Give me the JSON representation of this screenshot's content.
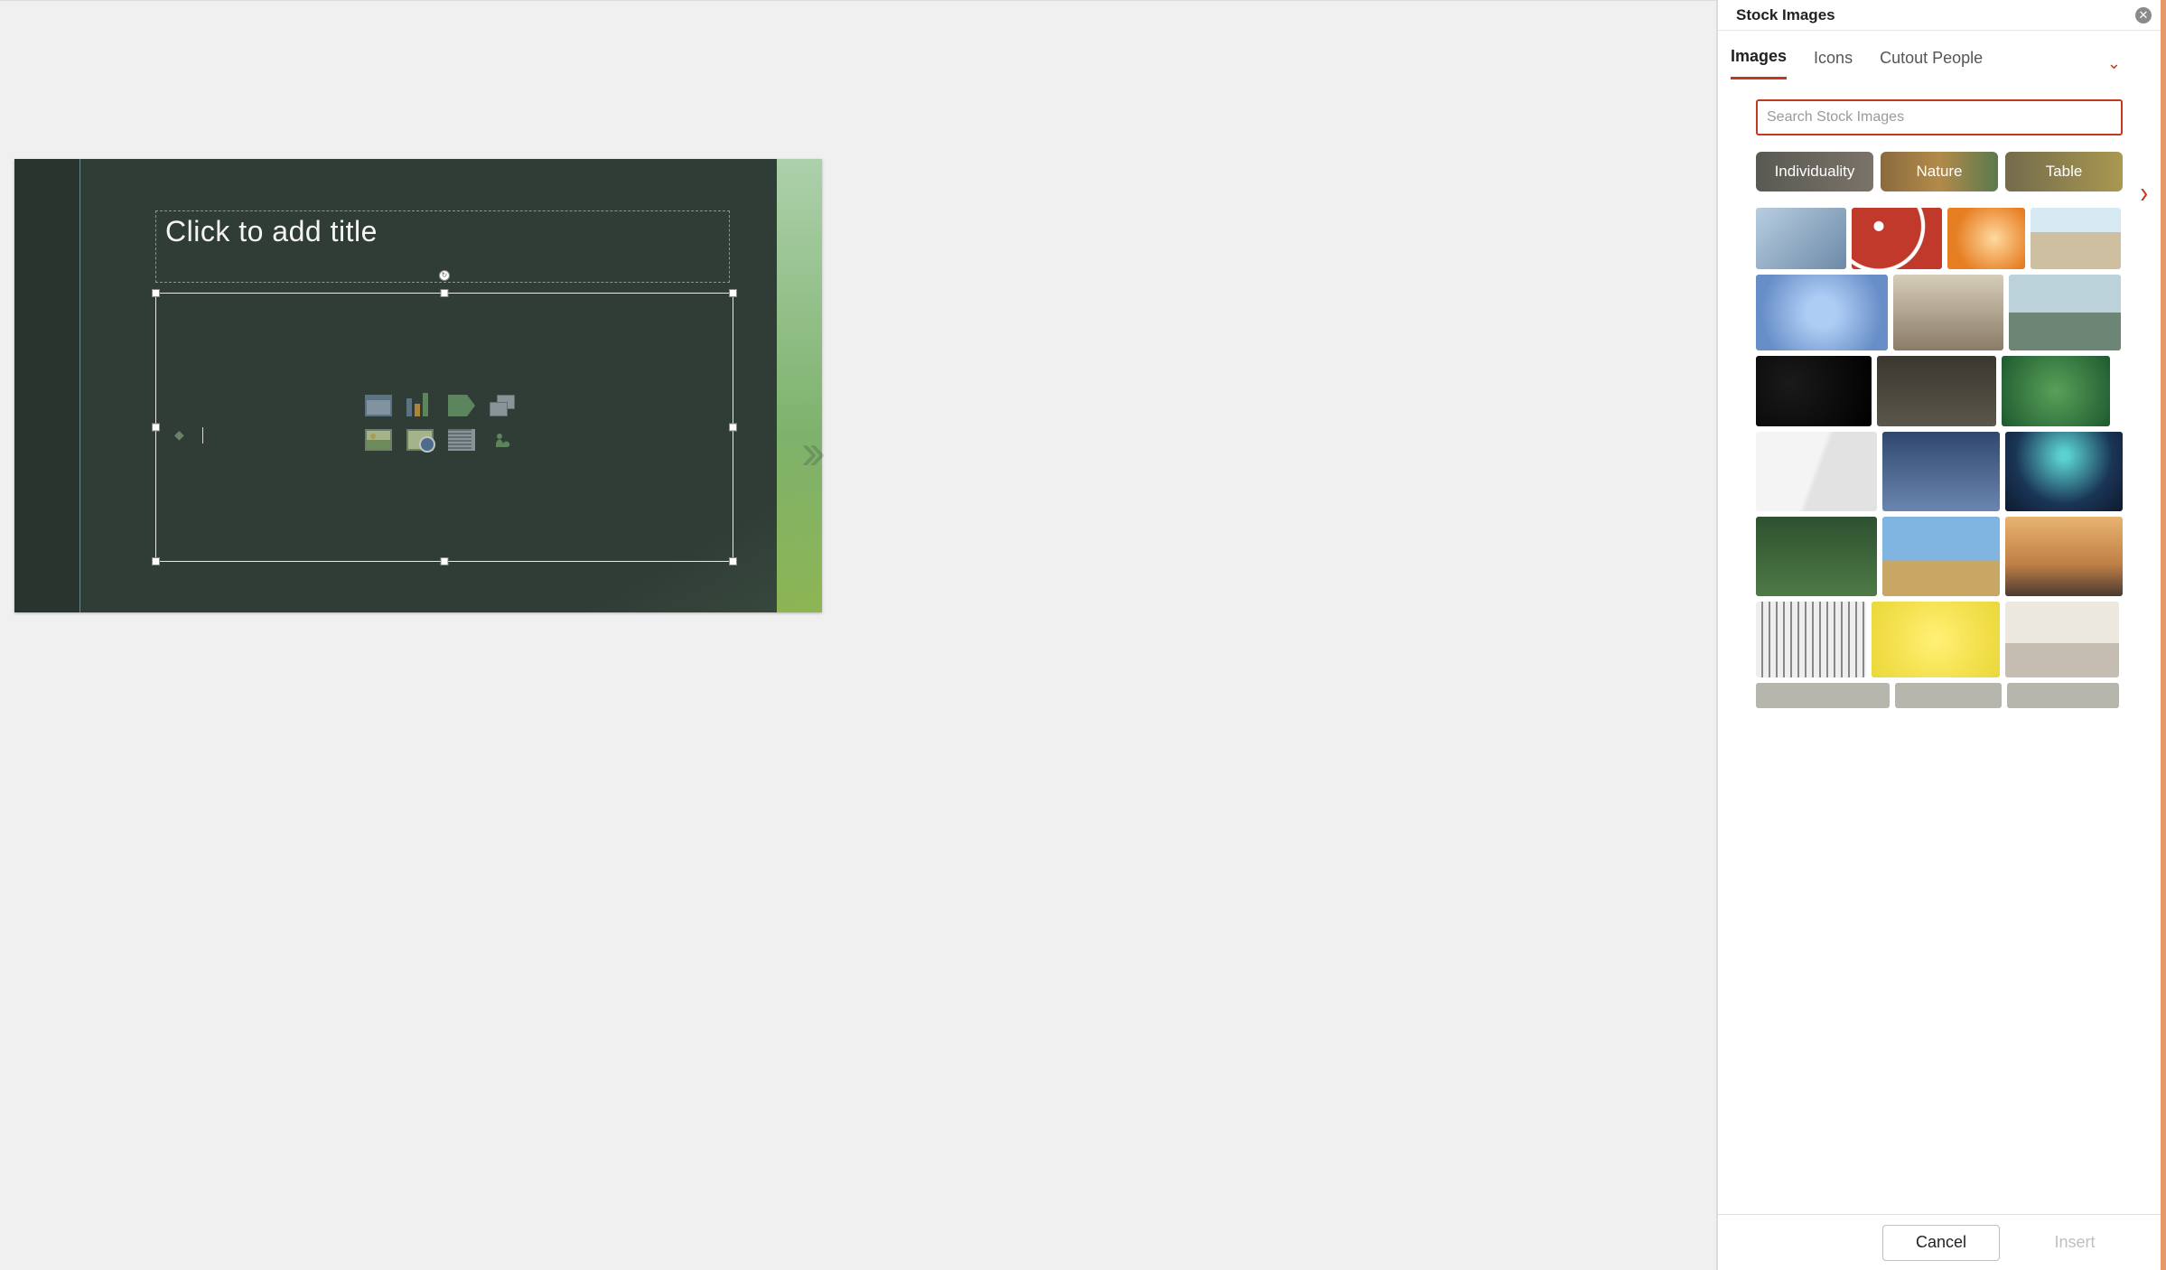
{
  "panel": {
    "title": "Stock Images",
    "tabs": {
      "images": "Images",
      "icons": "Icons",
      "cutout": "Cutout People"
    },
    "search_placeholder": "Search Stock Images",
    "categories": {
      "c1": "Individuality",
      "c2": "Nature",
      "c3": "Table"
    },
    "footer": {
      "cancel": "Cancel",
      "insert": "Insert"
    }
  },
  "slide": {
    "title_placeholder": "Click to add title"
  }
}
